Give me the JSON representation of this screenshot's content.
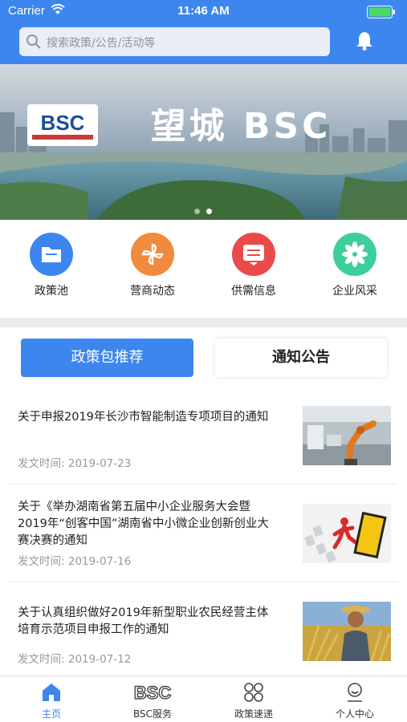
{
  "status_bar": {
    "carrier": "Carrier",
    "time": "11:46 AM"
  },
  "header": {
    "search_placeholder": "搜索政策/公告/活动等",
    "bell_icon": "bell-icon"
  },
  "banner": {
    "logo_text": "BSC",
    "title": "望城 BSC",
    "dots": 2,
    "active_dot": 1
  },
  "quick_menu": [
    {
      "label": "政策池",
      "icon": "folder-icon",
      "color": "#3d86ef"
    },
    {
      "label": "营商动态",
      "icon": "pinwheel-icon",
      "color": "#f08a3c"
    },
    {
      "label": "供需信息",
      "icon": "exchange-icon",
      "color": "#e94b4b"
    },
    {
      "label": "企业风采",
      "icon": "flower-icon",
      "color": "#3ccf9a"
    }
  ],
  "tabs": {
    "active": "政策包推荐",
    "inactive": "通知公告"
  },
  "news": [
    {
      "title": "关于申报2019年长沙市智能制造专项项目的通知",
      "date_label": "发文时间:",
      "date": "2019-07-23",
      "image": "robot-arm-photo"
    },
    {
      "title": "关于《举办湖南省第五届中小企业服务大会暨2019年“创客中国”湖南省中小微企业创新创业大赛决赛的通知",
      "date_label": "发文时间:",
      "date": "2019-07-16",
      "image": "entrepreneur-photo"
    },
    {
      "title": "关于认真组织做好2019年新型职业农民经营主体培育示范项目申报工作的通知",
      "date_label": "发文时间:",
      "date": "2019-07-12",
      "image": "farmer-photo"
    }
  ],
  "tabbar": [
    {
      "label": "主页",
      "icon": "home-icon",
      "active": true
    },
    {
      "label": "BSC服务",
      "icon": "bsc-logo-icon",
      "active": false
    },
    {
      "label": "政策速递",
      "icon": "grid-circles-icon",
      "active": false
    },
    {
      "label": "个人中心",
      "icon": "user-icon",
      "active": false
    }
  ]
}
